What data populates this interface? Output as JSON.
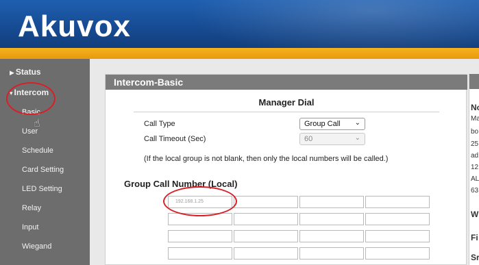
{
  "brand": {
    "logo_text": "Akuvox"
  },
  "sidebar": {
    "items": [
      {
        "label": "Status",
        "type": "top"
      },
      {
        "label": "Intercom",
        "type": "top"
      },
      {
        "label": "Basic",
        "type": "sub"
      },
      {
        "label": "User",
        "type": "sub"
      },
      {
        "label": "Schedule",
        "type": "sub"
      },
      {
        "label": "Card Setting",
        "type": "sub"
      },
      {
        "label": "LED Setting",
        "type": "sub"
      },
      {
        "label": "Relay",
        "type": "sub"
      },
      {
        "label": "Input",
        "type": "sub"
      },
      {
        "label": "Wiegand",
        "type": "sub"
      }
    ]
  },
  "panel": {
    "title": "Intercom-Basic",
    "section_title": "Manager Dial",
    "call_type_label": "Call Type",
    "call_type_value": "Group Call",
    "call_timeout_label": "Call Timeout (Sec)",
    "call_timeout_value": "60",
    "note": "(If the local group is not blank, then only the local numbers will be called.)",
    "group_title": "Group Call Number (Local)",
    "group_numbers": [
      "192.168.1.25",
      "",
      "",
      "",
      "",
      "",
      "",
      "",
      "",
      "",
      "",
      ""
    ]
  },
  "right_panel": {
    "lines": [
      "Nc",
      "Ma",
      "bo",
      "25",
      "ad",
      "12",
      "AL",
      "63",
      "W",
      "Fi",
      "Sr"
    ]
  },
  "colors": {
    "header": "#1a56a3",
    "accent": "#f0a916",
    "sidebar": "#6d6d6d",
    "annotation": "#d81f26"
  }
}
